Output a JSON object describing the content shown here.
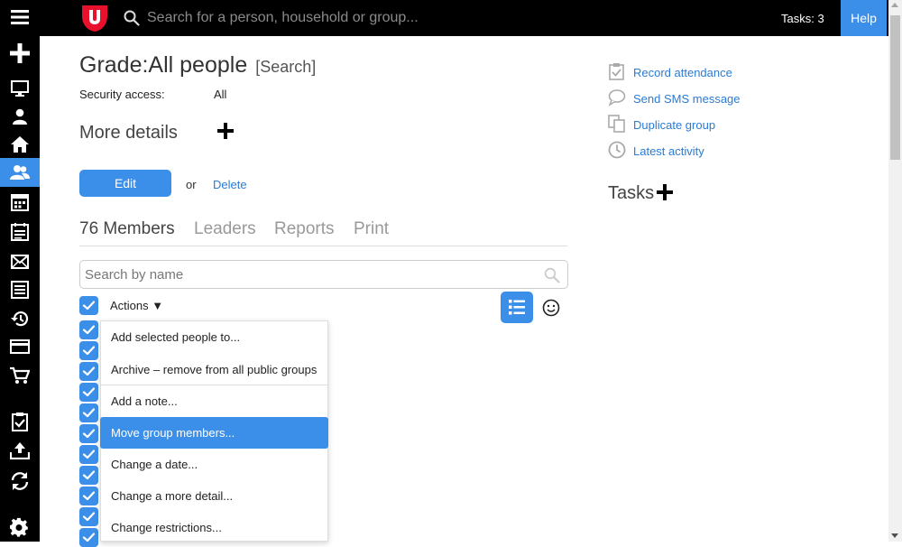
{
  "topbar": {
    "search_placeholder": "Search for a person, household or group...",
    "tasks_label": "Tasks: 3",
    "help_label": "Help",
    "logo_color": "#e8112d"
  },
  "sidebar": {
    "items": [
      {
        "icon": "menu-icon"
      },
      {
        "icon": "add-icon"
      },
      {
        "icon": "monitor-icon"
      },
      {
        "icon": "person-icon"
      },
      {
        "icon": "home-icon"
      },
      {
        "icon": "people-icon",
        "active": true
      },
      {
        "icon": "calendar-icon"
      },
      {
        "icon": "agenda-icon"
      },
      {
        "icon": "mail-icon"
      },
      {
        "icon": "table-icon"
      },
      {
        "icon": "history-icon"
      },
      {
        "icon": "card-icon"
      },
      {
        "icon": "cart-icon"
      },
      {
        "icon": "clipboard-check-icon"
      },
      {
        "icon": "upload-icon"
      },
      {
        "icon": "sync-icon"
      },
      {
        "icon": "settings-icon"
      }
    ]
  },
  "main": {
    "title": "Grade:All people",
    "title_search": "[Search]",
    "security_label": "Security access:",
    "security_value": "All",
    "more_details": "More details",
    "edit_label": "Edit",
    "or_text": "or",
    "delete_label": "Delete",
    "tabs": [
      {
        "label": "76 Members",
        "active": true
      },
      {
        "label": "Leaders"
      },
      {
        "label": "Reports"
      },
      {
        "label": "Print"
      }
    ],
    "search_placeholder": "Search by name",
    "actions_label": "Actions ▼",
    "actions_menu": [
      {
        "label": "Add selected people to..."
      },
      {
        "label": "Archive – remove from all public groups"
      },
      {
        "label": "Add a note..."
      },
      {
        "label": "Move group members...",
        "selected": true
      },
      {
        "label": "Change a date..."
      },
      {
        "label": "Change a more detail..."
      },
      {
        "label": "Change restrictions..."
      }
    ]
  },
  "right": {
    "links": [
      {
        "label": "Record attendance",
        "icon": "clipboard-check-icon"
      },
      {
        "label": "Send SMS message",
        "icon": "speech-bubble-icon"
      },
      {
        "label": "Duplicate group",
        "icon": "copy-icon"
      },
      {
        "label": "Latest activity",
        "icon": "clock-icon"
      }
    ],
    "tasks_title": "Tasks"
  },
  "colors": {
    "accent": "#3c8fe8",
    "link": "#2b7bd3",
    "topbar": "#000000"
  }
}
